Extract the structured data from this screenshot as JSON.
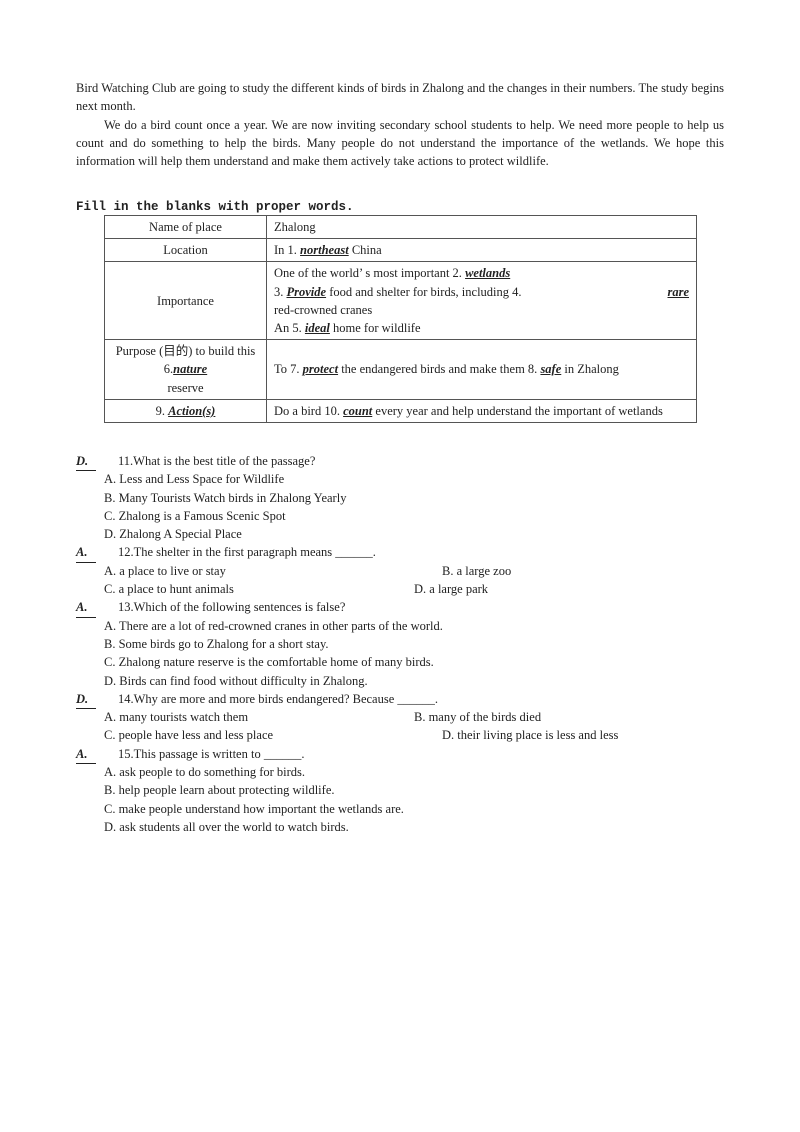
{
  "passage": {
    "p1": "Bird Watching Club are going to study the different kinds of birds in Zhalong and the changes in their numbers. The study begins next month.",
    "p2": "We do a bird count once a year. We are now inviting secondary school students to help. We need more people to help us count and do something to help the birds. Many people do not understand the importance of the wetlands. We hope this information will help them understand and make them actively take actions to protect wildlife."
  },
  "instruction": "Fill in the blanks with proper words.",
  "table": {
    "rows": [
      {
        "label": "Name of place",
        "content": "Zhalong"
      },
      {
        "label": "Location",
        "pre": "In 1. ",
        "answer": "northeast",
        "post": " China"
      },
      {
        "label": "Importance",
        "line1_pre": "One of the world’ s most important 2. ",
        "line1_answer": "wetlands",
        "line2_pre": "3. ",
        "line2_answer": "Provide",
        "line2_mid": " food and shelter for birds, including 4. ",
        "line2_answer2": "rare",
        "line3": "red-crowned cranes",
        "line4_pre": "An 5. ",
        "line4_answer": "ideal",
        "line4_post": " home for wildlife"
      },
      {
        "label_pre": "Purpose (目的) to build this 6.",
        "label_answer": "nature",
        "label_post": "reserve",
        "pre": "To 7. ",
        "answer": "protect",
        "mid": " the endangered birds and make them 8. ",
        "answer2": "safe",
        "post": " in Zhalong"
      },
      {
        "label_pre": "9. ",
        "label_answer": "Action(s)",
        "pre": "Do a bird 10. ",
        "answer": "count",
        "post": " every year and help understand the important of wetlands"
      }
    ]
  },
  "questions": [
    {
      "answer": "D.",
      "number": "11.",
      "text": "What is the best title of the passage?",
      "options": [
        "A. Less and Less Space for Wildlife",
        "B. Many Tourists Watch birds in Zhalong Yearly",
        "C. Zhalong is a Famous Scenic Spot",
        "D. Zhalong A Special Place"
      ]
    },
    {
      "answer": "A.",
      "number": "12.",
      "text": "The shelter in the first paragraph means ______.",
      "options": [
        "A. a place to live or stay",
        "B. a large zoo",
        "C. a place to hunt animals",
        "D. a large park"
      ]
    },
    {
      "answer": "A.",
      "number": "13.",
      "text": "Which of the following sentences is false?",
      "options": [
        "A. There are a lot of red-crowned cranes in other parts of the world.",
        "B. Some birds go to Zhalong for a short stay.",
        "C. Zhalong nature reserve is the comfortable home of many birds.",
        "D. Birds can find food without difficulty in Zhalong."
      ]
    },
    {
      "answer": "D.",
      "number": "14.",
      "text": "Why are more and more birds endangered? Because ______.",
      "options": [
        "A. many tourists watch them",
        "B. many of the birds died",
        "C. people have less and less place",
        "D. their living place is less and less"
      ]
    },
    {
      "answer": "A.",
      "number": "15.",
      "text": "This passage is written to ______.",
      "options": [
        "A. ask people to do something for birds.",
        "B. help people learn about protecting wildlife.",
        "C. make people understand how important the wetlands are.",
        "D. ask students all over the world to watch birds."
      ]
    }
  ]
}
